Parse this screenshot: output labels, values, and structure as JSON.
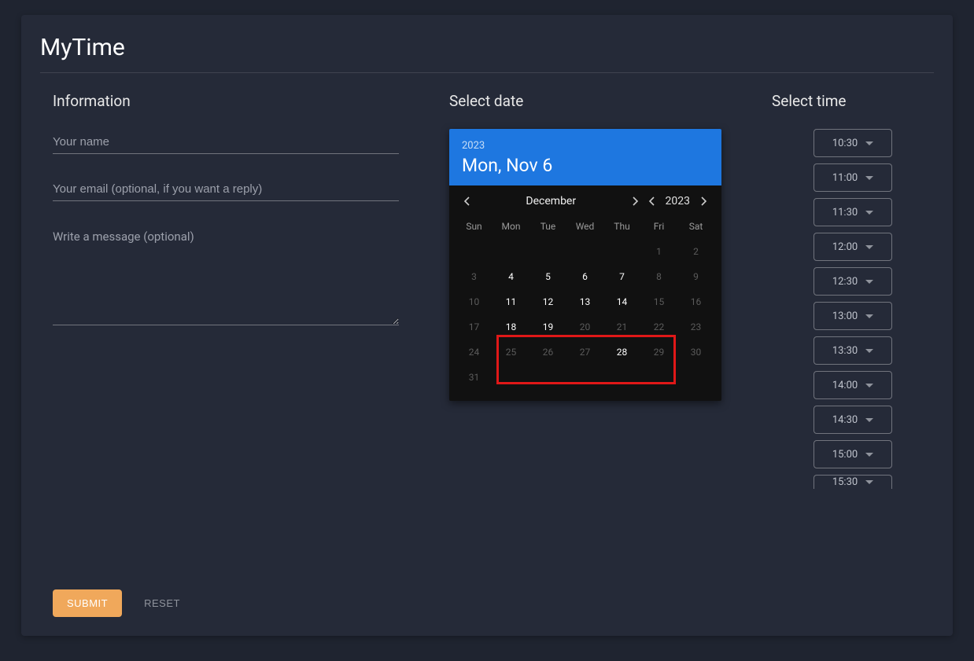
{
  "app_title": "MyTime",
  "info": {
    "title": "Information",
    "name_placeholder": "Your name",
    "name_value": "",
    "email_placeholder": "Your email (optional, if you want a reply)",
    "email_value": "",
    "message_placeholder": "Write a message (optional)",
    "message_value": ""
  },
  "date": {
    "title": "Select date",
    "header_year": "2023",
    "header_date": "Mon, Nov 6",
    "month_label": "December",
    "year_label": "2023",
    "weekdays": [
      "Sun",
      "Mon",
      "Tue",
      "Wed",
      "Thu",
      "Fri",
      "Sat"
    ],
    "rows": [
      [
        {
          "n": "",
          "s": "empty"
        },
        {
          "n": "",
          "s": "empty"
        },
        {
          "n": "",
          "s": "empty"
        },
        {
          "n": "",
          "s": "empty"
        },
        {
          "n": "",
          "s": "empty"
        },
        {
          "n": "1",
          "s": "disabled"
        },
        {
          "n": "2",
          "s": "disabled"
        }
      ],
      [
        {
          "n": "3",
          "s": "disabled"
        },
        {
          "n": "4",
          "s": "ok"
        },
        {
          "n": "5",
          "s": "ok"
        },
        {
          "n": "6",
          "s": "ok"
        },
        {
          "n": "7",
          "s": "ok"
        },
        {
          "n": "8",
          "s": "disabled"
        },
        {
          "n": "9",
          "s": "disabled"
        }
      ],
      [
        {
          "n": "10",
          "s": "disabled"
        },
        {
          "n": "11",
          "s": "ok"
        },
        {
          "n": "12",
          "s": "ok"
        },
        {
          "n": "13",
          "s": "ok"
        },
        {
          "n": "14",
          "s": "ok"
        },
        {
          "n": "15",
          "s": "disabled"
        },
        {
          "n": "16",
          "s": "disabled"
        }
      ],
      [
        {
          "n": "17",
          "s": "disabled"
        },
        {
          "n": "18",
          "s": "ok"
        },
        {
          "n": "19",
          "s": "ok"
        },
        {
          "n": "20",
          "s": "disabled"
        },
        {
          "n": "21",
          "s": "disabled"
        },
        {
          "n": "22",
          "s": "disabled"
        },
        {
          "n": "23",
          "s": "disabled"
        }
      ],
      [
        {
          "n": "24",
          "s": "disabled"
        },
        {
          "n": "25",
          "s": "disabled"
        },
        {
          "n": "26",
          "s": "disabled"
        },
        {
          "n": "27",
          "s": "disabled"
        },
        {
          "n": "28",
          "s": "ok"
        },
        {
          "n": "29",
          "s": "disabled"
        },
        {
          "n": "30",
          "s": "disabled"
        }
      ],
      [
        {
          "n": "31",
          "s": "disabled"
        },
        {
          "n": "",
          "s": "empty"
        },
        {
          "n": "",
          "s": "empty"
        },
        {
          "n": "",
          "s": "empty"
        },
        {
          "n": "",
          "s": "empty"
        },
        {
          "n": "",
          "s": "empty"
        },
        {
          "n": "",
          "s": "empty"
        }
      ]
    ]
  },
  "time": {
    "title": "Select time",
    "slots": [
      "10:30",
      "11:00",
      "11:30",
      "12:00",
      "12:30",
      "13:00",
      "13:30",
      "14:00",
      "14:30",
      "15:00",
      "15:30"
    ]
  },
  "actions": {
    "submit": "SUBMIT",
    "reset": "RESET"
  }
}
